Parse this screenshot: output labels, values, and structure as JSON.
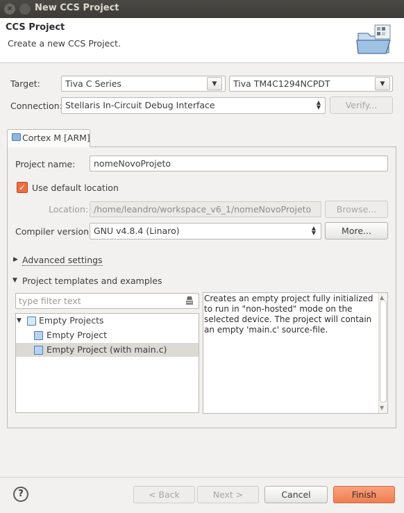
{
  "window": {
    "title": "New CCS Project",
    "close_glyph": "×"
  },
  "banner": {
    "title": "CCS Project",
    "subtitle": "Create a new CCS Project.",
    "icon": "folder-wizard-icon"
  },
  "target": {
    "label": "Target:",
    "family": "Tiva C Series",
    "device": "Tiva TM4C1294NCPDT"
  },
  "connection": {
    "label": "Connection:",
    "value": "Stellaris In-Circuit Debug Interface",
    "verify_label": "Verify..."
  },
  "tab": {
    "label": "Cortex M [ARM]"
  },
  "project": {
    "name_label": "Project name:",
    "name_value": "nomeNovoProjeto",
    "default_location_label": "Use default location",
    "default_location_checked": true,
    "location_label": "Location:",
    "location_value": "/home/leandro/workspace_v6_1/nomeNovoProjeto",
    "browse_label": "Browse...",
    "compiler_label": "Compiler version:",
    "compiler_value": "GNU v4.8.4 (Linaro)",
    "more_label": "More..."
  },
  "advanced": {
    "label": "Advanced settings",
    "expanded": false
  },
  "templates": {
    "label": "Project templates and examples",
    "expanded": true,
    "filter_placeholder": "type filter text",
    "tree": [
      {
        "label": "Empty Projects",
        "level": 0,
        "expanded": true
      },
      {
        "label": "Empty Project",
        "level": 1
      },
      {
        "label": "Empty Project (with main.c)",
        "level": 1,
        "selected": true
      }
    ],
    "description": "Creates an empty project fully initialized\nto run in \"non-hosted\" mode on the\nselected device. The project will contain\nan empty 'main.c' source-file."
  },
  "footer": {
    "help_glyph": "?",
    "back_label": "< Back",
    "next_label": "Next >",
    "cancel_label": "Cancel",
    "finish_label": "Finish"
  },
  "colors": {
    "accent": "#ef7e51",
    "titlebar": "#3c3b37",
    "background": "#f2f1f0"
  }
}
